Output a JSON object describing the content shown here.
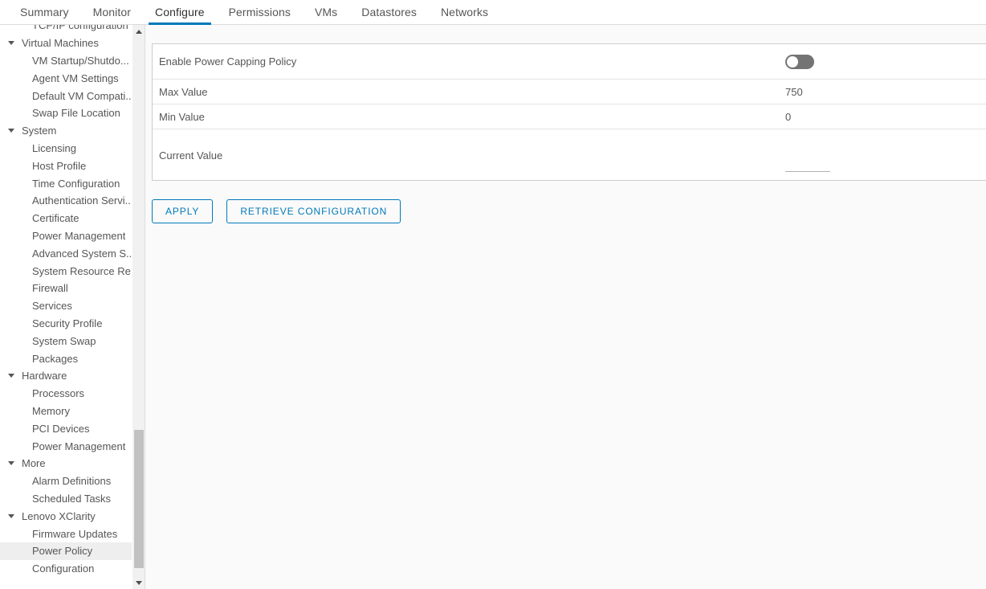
{
  "tabs": [
    {
      "label": "Summary",
      "active": false
    },
    {
      "label": "Monitor",
      "active": false
    },
    {
      "label": "Configure",
      "active": true
    },
    {
      "label": "Permissions",
      "active": false
    },
    {
      "label": "VMs",
      "active": false
    },
    {
      "label": "Datastores",
      "active": false
    },
    {
      "label": "Networks",
      "active": false
    }
  ],
  "sidebar": {
    "items": [
      {
        "label": "TCP/IP configuration",
        "type": "leaf",
        "selected": false
      },
      {
        "label": "Virtual Machines",
        "type": "group",
        "selected": false
      },
      {
        "label": "VM Startup/Shutdo...",
        "type": "leaf",
        "selected": false
      },
      {
        "label": "Agent VM Settings",
        "type": "leaf",
        "selected": false
      },
      {
        "label": "Default VM Compati..",
        "type": "leaf",
        "selected": false
      },
      {
        "label": "Swap File Location",
        "type": "leaf",
        "selected": false
      },
      {
        "label": "System",
        "type": "group",
        "selected": false
      },
      {
        "label": "Licensing",
        "type": "leaf",
        "selected": false
      },
      {
        "label": "Host Profile",
        "type": "leaf",
        "selected": false
      },
      {
        "label": "Time Configuration",
        "type": "leaf",
        "selected": false
      },
      {
        "label": "Authentication Servi..",
        "type": "leaf",
        "selected": false
      },
      {
        "label": "Certificate",
        "type": "leaf",
        "selected": false
      },
      {
        "label": "Power Management",
        "type": "leaf",
        "selected": false
      },
      {
        "label": "Advanced System S..",
        "type": "leaf",
        "selected": false
      },
      {
        "label": "System Resource Re.",
        "type": "leaf",
        "selected": false
      },
      {
        "label": "Firewall",
        "type": "leaf",
        "selected": false
      },
      {
        "label": "Services",
        "type": "leaf",
        "selected": false
      },
      {
        "label": "Security Profile",
        "type": "leaf",
        "selected": false
      },
      {
        "label": "System Swap",
        "type": "leaf",
        "selected": false
      },
      {
        "label": "Packages",
        "type": "leaf",
        "selected": false
      },
      {
        "label": "Hardware",
        "type": "group",
        "selected": false
      },
      {
        "label": "Processors",
        "type": "leaf",
        "selected": false
      },
      {
        "label": "Memory",
        "type": "leaf",
        "selected": false
      },
      {
        "label": "PCI Devices",
        "type": "leaf",
        "selected": false
      },
      {
        "label": "Power Management",
        "type": "leaf",
        "selected": false
      },
      {
        "label": "More",
        "type": "group",
        "selected": false
      },
      {
        "label": "Alarm Definitions",
        "type": "leaf",
        "selected": false
      },
      {
        "label": "Scheduled Tasks",
        "type": "leaf",
        "selected": false
      },
      {
        "label": "Lenovo XClarity",
        "type": "group",
        "selected": false
      },
      {
        "label": "Firmware Updates",
        "type": "leaf",
        "selected": false
      },
      {
        "label": "Power Policy",
        "type": "leaf",
        "selected": true
      },
      {
        "label": "Configuration",
        "type": "leaf",
        "selected": false
      }
    ],
    "scrollbar": {
      "up_icon": "triangle-up-icon",
      "down_icon": "triangle-down-icon"
    }
  },
  "panel": {
    "rows": [
      {
        "label": "Enable Power Capping Policy",
        "control": "toggle",
        "value": "off"
      },
      {
        "label": "Max Value",
        "control": "text",
        "value": "750"
      },
      {
        "label": "Min Value",
        "control": "text",
        "value": "0"
      },
      {
        "label": "Current Value",
        "control": "input",
        "value": "",
        "placeholder": ""
      }
    ]
  },
  "actions": {
    "apply_label": "Apply",
    "retrieve_label": "Retrieve Configuration"
  },
  "colors": {
    "accent": "#0079b8",
    "text": "#565656",
    "selected_row": "#eeeeee",
    "toggle_off_track": "#747474",
    "panel_border": "#cccccc",
    "page_bg": "#fafafa"
  }
}
